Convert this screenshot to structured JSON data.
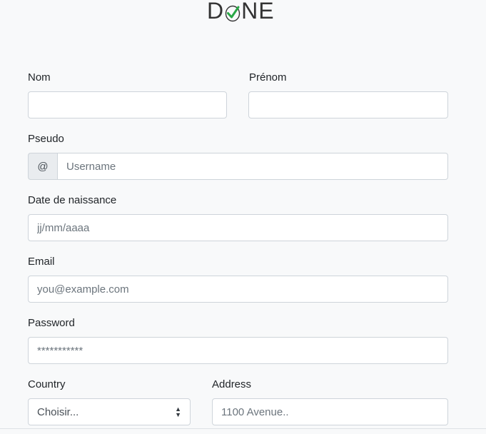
{
  "logo": {
    "text_left": "D",
    "text_right": "NE",
    "check_color": "#28a745"
  },
  "form": {
    "nom": {
      "label": "Nom",
      "value": "",
      "placeholder": ""
    },
    "prenom": {
      "label": "Prénom",
      "value": "",
      "placeholder": ""
    },
    "pseudo": {
      "label": "Pseudo",
      "prefix": "@",
      "value": "",
      "placeholder": "Username"
    },
    "birthdate": {
      "label": "Date de naissance",
      "placeholder": "jj/mm/aaaa"
    },
    "email": {
      "label": "Email",
      "value": "",
      "placeholder": "you@example.com"
    },
    "password": {
      "label": "Password",
      "value": "",
      "placeholder": "***********"
    },
    "country": {
      "label": "Country",
      "selected": "Choisir..."
    },
    "address": {
      "label": "Address",
      "value": "",
      "placeholder": "1100 Avenue.."
    }
  },
  "colors": {
    "background": "#f8f9fa",
    "border": "#ced4da",
    "prefix_bg": "#e9ecef",
    "placeholder": "#6c757d"
  }
}
